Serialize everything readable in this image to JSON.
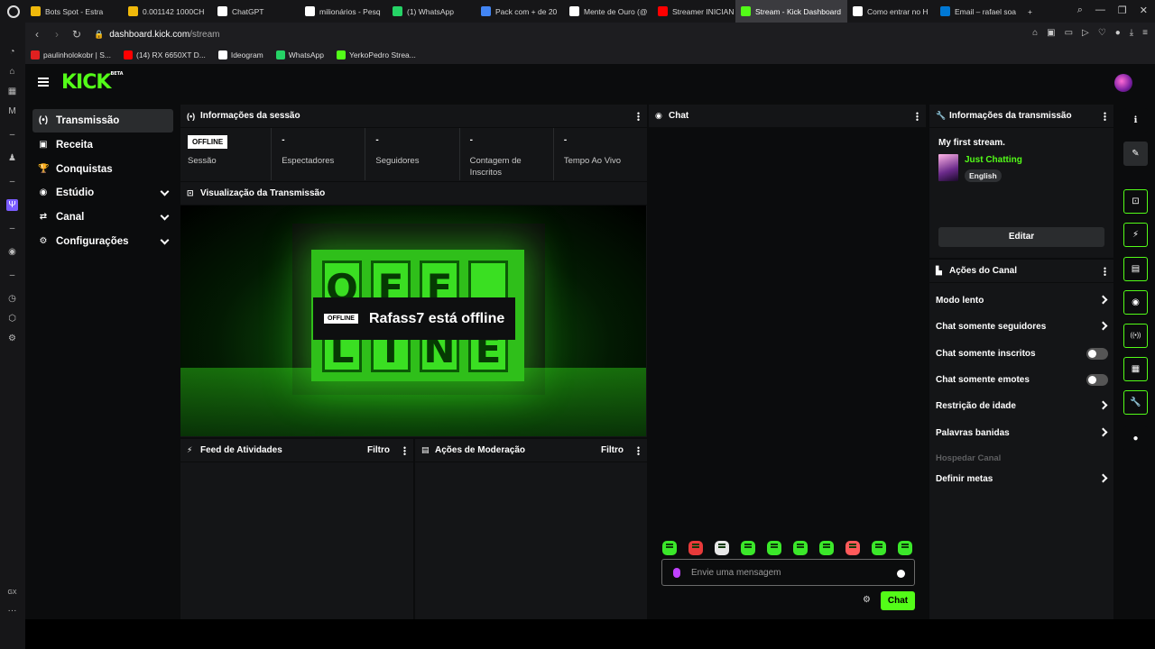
{
  "browser": {
    "tabs": [
      {
        "label": "Bots Spot - Estra",
        "fav": "#f0b90b",
        "w": 108
      },
      {
        "label": "0.001142 1000CH",
        "fav": "#f0b90b",
        "w": 99
      },
      {
        "label": "ChatGPT",
        "fav": "#ffffff",
        "w": 97
      },
      {
        "label": "milionários - Pesq",
        "fav": "#ffffff",
        "w": 97
      },
      {
        "label": "(1) WhatsApp",
        "fav": "#25d366",
        "w": 98
      },
      {
        "label": "Pack com + de 20",
        "fav": "#4285f4",
        "w": 98
      },
      {
        "label": "Mente de Ouro (@",
        "fav": "#ffffff",
        "w": 98
      },
      {
        "label": "Streamer INICIAN",
        "fav": "#ff0000",
        "w": 92
      },
      {
        "label": "Stream - Kick Dashboard",
        "fav": "#53fc18",
        "w": 124,
        "active": true
      },
      {
        "label": "Como entrar no H",
        "fav": "#ffffff",
        "w": 97
      },
      {
        "label": "Email – rafael soa",
        "fav": "#0078d4",
        "w": 97
      }
    ],
    "new_tab": "+",
    "url_host": "dashboard.kick.com",
    "url_path": "/stream",
    "bookmarks": [
      {
        "label": "paulinholokobr | S...",
        "color": "#e02020"
      },
      {
        "label": "(14) RX 6650XT D...",
        "color": "#ff0000"
      },
      {
        "label": "Ideogram",
        "color": "#ffffff"
      },
      {
        "label": "WhatsApp",
        "color": "#25d366"
      },
      {
        "label": "YerkoPedro Strea...",
        "color": "#53fc18"
      }
    ],
    "side_label_gx": "GX",
    "side_more": "···"
  },
  "kick": {
    "logo": "KICK",
    "logo_badge": "BETA",
    "accent": "#53fc18",
    "sidebar": [
      {
        "label": "Transmissão",
        "icon": "broadcast-icon",
        "glyph": "(•)",
        "active": true
      },
      {
        "label": "Receita",
        "icon": "revenue-icon",
        "glyph": "▣"
      },
      {
        "label": "Conquistas",
        "icon": "trophy-icon",
        "glyph": "🏆"
      },
      {
        "label": "Estúdio",
        "icon": "studio-icon",
        "glyph": "◉",
        "expandable": true
      },
      {
        "label": "Canal",
        "icon": "channel-icon",
        "glyph": "⇄",
        "expandable": true
      },
      {
        "label": "Configurações",
        "icon": "settings-icon",
        "glyph": "⚙",
        "expandable": true
      }
    ],
    "session": {
      "title": "Informações da sessão",
      "stats": [
        {
          "value": "OFFLINE",
          "label": "Sessão",
          "badge": true
        },
        {
          "value": "-",
          "label": "Espectadores"
        },
        {
          "value": "-",
          "label": "Seguidores"
        },
        {
          "value": "-",
          "label": "Contagem de Inscritos"
        },
        {
          "value": "-",
          "label": "Tempo Ao Vivo"
        }
      ]
    },
    "preview": {
      "title": "Visualização da Transmissão",
      "badge": "OFFLINE",
      "status_text": "Rafass7 está offline",
      "sign_letters": [
        "O",
        "F",
        "F",
        "",
        "L",
        "I",
        "N",
        "E"
      ]
    },
    "activity": {
      "title": "Feed de Atividades",
      "filter": "Filtro"
    },
    "moderation": {
      "title": "Ações de Moderação",
      "filter": "Filtro"
    },
    "chat": {
      "title": "Chat",
      "placeholder": "Envie uma mensagem",
      "send_label": "Chat",
      "emote_count": 10
    },
    "stream_info": {
      "title": "Informações da transmissão",
      "stream_title": "My first stream.",
      "category": "Just Chatting",
      "language": "English",
      "edit_label": "Editar"
    },
    "channel_actions": {
      "title": "Ações do Canal",
      "items": [
        {
          "label": "Modo lento",
          "control": "arrow"
        },
        {
          "label": "Chat somente seguidores",
          "control": "arrow"
        },
        {
          "label": "Chat somente inscritos",
          "control": "toggle",
          "on": false
        },
        {
          "label": "Chat somente emotes",
          "control": "toggle",
          "on": false
        },
        {
          "label": "Restrição de idade",
          "control": "arrow"
        },
        {
          "label": "Palavras banidas",
          "control": "arrow"
        },
        {
          "label": "Hospedar Canal",
          "control": "none",
          "disabled": true
        },
        {
          "label": "Definir metas",
          "control": "arrow"
        }
      ]
    },
    "right_tools": [
      {
        "name": "info-icon",
        "glyph": "ℹ",
        "style": "plain"
      },
      {
        "name": "edit-icon",
        "glyph": "✎",
        "style": "grey"
      },
      {
        "name": "screen-capture-icon",
        "glyph": "⊡",
        "style": "outline"
      },
      {
        "name": "lightning-icon",
        "glyph": "⚡",
        "style": "outline"
      },
      {
        "name": "document-icon",
        "glyph": "▤",
        "style": "outline"
      },
      {
        "name": "chat-bubble-icon",
        "glyph": "◉",
        "style": "outline"
      },
      {
        "name": "broadcast-icon",
        "glyph": "((•))",
        "style": "outline"
      },
      {
        "name": "panels-icon",
        "glyph": "▦",
        "style": "outline"
      },
      {
        "name": "wrench-icon",
        "glyph": "🔧",
        "style": "outline"
      },
      {
        "name": "bubbles-icon",
        "glyph": "●",
        "style": "plain"
      }
    ]
  }
}
